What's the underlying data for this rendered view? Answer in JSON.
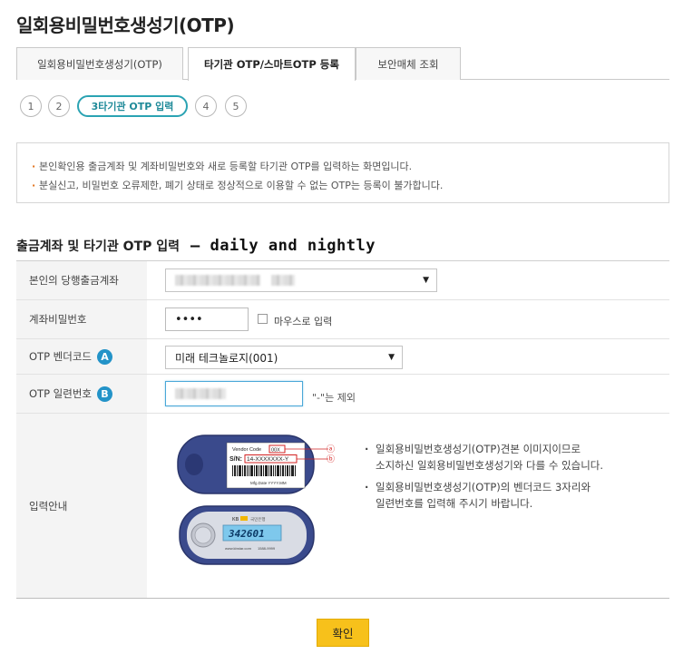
{
  "page": {
    "title": "일회용비밀번호생성기(OTP)"
  },
  "tabs": [
    {
      "label": "일회용비밀번호생성기(OTP)"
    },
    {
      "label": "타기관 OTP/스마트OTP 등록"
    },
    {
      "label": "보안매체 조회"
    }
  ],
  "steps": [
    {
      "label": "1"
    },
    {
      "label": "2"
    },
    {
      "label": "3타기관 OTP 입력"
    },
    {
      "label": "4"
    },
    {
      "label": "5"
    }
  ],
  "info": [
    "본인확인용 출금계좌 및 계좌비밀번호와 새로 등록할 타기관 OTP를 입력하는 화면입니다.",
    "분실신고, 비밀번호 오류제한, 폐기 상태로 정상적으로 이용할 수 없는 OTP는 등록이 불가합니다."
  ],
  "section": {
    "title": "출금계좌 및 타기관 OTP 입력",
    "extra": "– daily and nightly"
  },
  "form": {
    "account_label": "본인의 당행출금계좌",
    "password_label": "계좌비밀번호",
    "password_value": "••••",
    "mouse_input_label": "마우스로 입력",
    "vendor_label": "OTP 벤더코드",
    "vendor_badge": "A",
    "vendor_value": "미래 테크놀로지(001)",
    "serial_label": "OTP 일련번호",
    "serial_badge": "B",
    "serial_hint": "\"-\"는 제외",
    "guide_label": "입력안내"
  },
  "guide": {
    "lines": [
      "일회용비밀번호생성기(OTP)견본 이미지이므로",
      "소지하신 일회용비밀번호생성기와 다를 수 있습니다.",
      "일회용비밀번호생성기(OTP)의 벤더코드 3자리와",
      "일련번호를 입력해 주시기 바랍니다."
    ],
    "device": {
      "vendor_code_label": "Vendor Code",
      "vendor_code_value": "00X",
      "sn_label": "S/N:",
      "sn_value": "14-XXXXXXX-Y",
      "mfg_date": "Mfg.Date YYYY.MM",
      "marker_a": "ⓐ",
      "marker_b": "ⓑ",
      "display_value": "342601",
      "brand_left": "KB",
      "brand_right": "국민은행",
      "footer_url": "www.kbstar.com",
      "footer_tel": "1588-9999"
    }
  },
  "buttons": {
    "confirm": "확인"
  },
  "colors": {
    "accent_teal": "#2ba3b3",
    "badge_blue": "#2393c8",
    "confirm_yellow": "#f7c11b",
    "bullet_orange": "#e0701a"
  }
}
